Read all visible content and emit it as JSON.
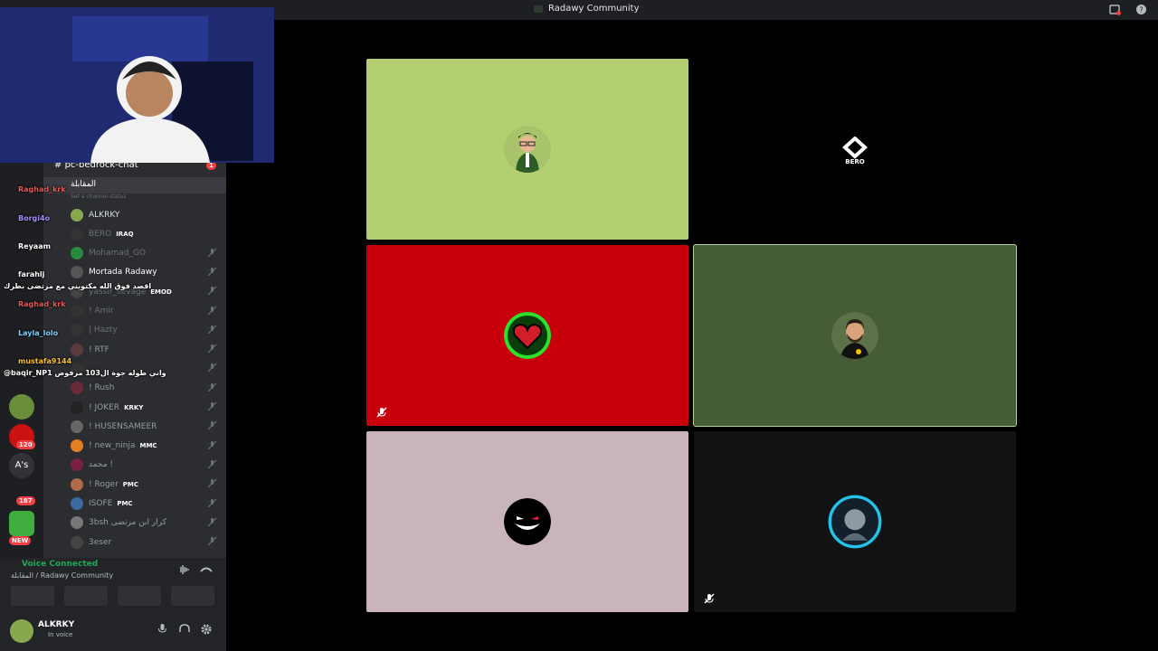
{
  "window": {
    "title": "Radawy Community"
  },
  "voice_grid": {
    "tiles": [
      {
        "name": "tile-lime",
        "bg": "#b3cf71",
        "avatar": "man-glasses"
      },
      {
        "name": "tile-bero",
        "bg": "#000000",
        "logo_text": "BERO"
      },
      {
        "name": "tile-red-heart",
        "bg": "#c8000b",
        "avatar": "pixel-heart",
        "muted": true
      },
      {
        "name": "tile-green-speaking",
        "bg": "#455c37",
        "avatar": "bearded-man"
      },
      {
        "name": "tile-pink",
        "bg": "#c9b4bc",
        "avatar": "grin-face"
      },
      {
        "name": "tile-dark",
        "bg": "#111214",
        "avatar": "blue-ring-face",
        "muted": true
      }
    ]
  },
  "sidebar": {
    "text_channel": "pc-bedrock-chat",
    "voice_channel": "المقابلة",
    "channel_status_placeholder": "Set a channel status",
    "voice_members": [
      {
        "name": "ALKRKY",
        "tag": "",
        "color": "#dbdee1"
      },
      {
        "name": "BERO",
        "tag": "IRAQ",
        "color": "#6d6f78"
      },
      {
        "name": "Mohamad_GO",
        "tag": "",
        "color": "#6d6f78"
      },
      {
        "name": "Mortada Radawy",
        "tag": "",
        "color": "#ffffff"
      },
      {
        "name": "yassir_sevage",
        "tag": "EMOD",
        "color": "#6d6f78"
      },
      {
        "name": "! Amir",
        "tag": "",
        "color": "#6d6f78"
      },
      {
        "name": "| Hazty",
        "tag": "",
        "color": "#6d6f78"
      },
      {
        "name": "! RTF",
        "tag": "",
        "color": "#949ba4"
      },
      {
        "name": "",
        "tag": "",
        "color": "#949ba4"
      },
      {
        "name": "! Rush",
        "tag": "",
        "color": "#949ba4"
      },
      {
        "name": "! JOKER",
        "tag": "KRKY",
        "color": "#949ba4"
      },
      {
        "name": "! HUSENSAMEER",
        "tag": "",
        "color": "#949ba4"
      },
      {
        "name": "! new_ninja",
        "tag": "MMC",
        "color": "#949ba4"
      },
      {
        "name": "محمد !",
        "tag": "",
        "color": "#949ba4"
      },
      {
        "name": "! Roger",
        "tag": "PMC",
        "color": "#949ba4"
      },
      {
        "name": "ISOFE",
        "tag": "PMC",
        "color": "#949ba4"
      },
      {
        "name": "3bsh كرار ابن مرتضى",
        "tag": "",
        "color": "#949ba4"
      },
      {
        "name": "3eser",
        "tag": "",
        "color": "#949ba4"
      }
    ],
    "server_labels": {
      "as": "A's",
      "new": "NEW",
      "badge_120": "120",
      "badge_187": "187"
    }
  },
  "chat_overlay": [
    {
      "user": "Raghad_krk",
      "color": "#e05a5a"
    },
    {
      "user": "Borgi4o",
      "color": "#a78bfa"
    },
    {
      "user": "Reyaam",
      "color": "#ffffff"
    },
    {
      "user": "farahlj",
      "color": "#ffffff"
    },
    {
      "msg": "اقصد فوق الله مكتوبني مع مرتضى بطرك"
    },
    {
      "user": "Raghad_krk",
      "color": "#e05a5a"
    },
    {
      "user": "Layla_lolo",
      "color": "#7dd3fc"
    },
    {
      "user": "mustafa9144",
      "color": "#fbbf24"
    },
    {
      "msg": "@baqir_NP1 واني طوله جوة ال103 مرفوض"
    }
  ],
  "voice_panel": {
    "status": "Voice Connected",
    "location": "المقابلة / Radawy Community"
  },
  "user_panel": {
    "name": "ALKRKY",
    "status": "In voice"
  }
}
